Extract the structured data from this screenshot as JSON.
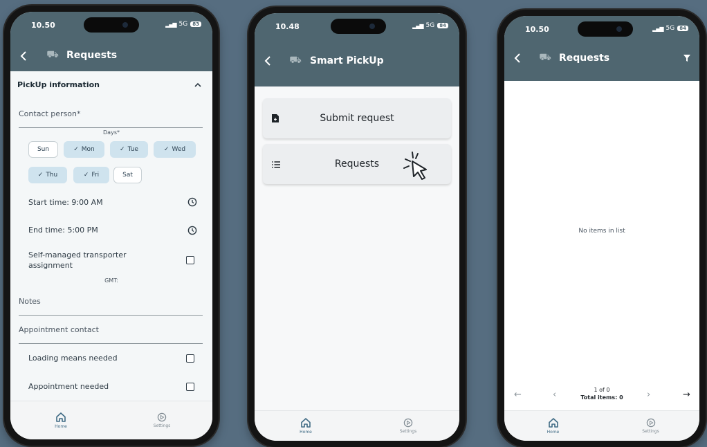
{
  "phones": [
    {
      "status": {
        "time": "10.50",
        "network": "5G",
        "battery": "83"
      },
      "appbar": {
        "title": "Requests"
      },
      "section": {
        "title": "PickUp information"
      },
      "fields": {
        "contact_person": "Contact person*",
        "days_label": "Days*",
        "start_time": "Start time: 9:00 AM",
        "end_time": "End time: 5:00 PM",
        "self_managed": "Self-managed transporter assignment",
        "gmt": "GMT:",
        "notes": "Notes",
        "appointment_contact": "Appointment contact",
        "loading_means": "Loading means needed",
        "appointment_needed": "Appointment needed"
      },
      "days": [
        {
          "label": "Sun",
          "selected": false
        },
        {
          "label": "Mon",
          "selected": true
        },
        {
          "label": "Tue",
          "selected": true
        },
        {
          "label": "Wed",
          "selected": true
        },
        {
          "label": "Thu",
          "selected": true
        },
        {
          "label": "Fri",
          "selected": true
        },
        {
          "label": "Sat",
          "selected": false
        }
      ],
      "nav": {
        "home": "Home",
        "settings": "Settings"
      }
    },
    {
      "status": {
        "time": "10.48",
        "network": "5G",
        "battery": "84"
      },
      "appbar": {
        "title": "Smart PickUp"
      },
      "menu": {
        "submit": "Submit request",
        "requests": "Requests"
      },
      "nav": {
        "home": "Home",
        "settings": "Settings"
      }
    },
    {
      "status": {
        "time": "10.50",
        "network": "5G",
        "battery": "84"
      },
      "appbar": {
        "title": "Requests"
      },
      "empty": "No items in list",
      "pager": {
        "page": "1 of 0",
        "total": "Total items: 0"
      },
      "nav": {
        "home": "Home",
        "settings": "Settings"
      }
    }
  ],
  "icons": [
    "back-arrow-icon",
    "truck-logo-icon",
    "chevron-up-icon",
    "check-icon",
    "clock-icon",
    "checkbox-icon",
    "home-icon",
    "settings-icon",
    "document-icon",
    "list-icon",
    "hand-pointer-icon",
    "filter-icon",
    "arrow-left-icon",
    "chevron-left-icon",
    "chevron-right-icon",
    "arrow-right-icon"
  ],
  "colors": {
    "appbar": "#4f6670",
    "background": "#566d80",
    "chip_selected": "#cfe3ee",
    "nav_active": "#3e6a84"
  }
}
